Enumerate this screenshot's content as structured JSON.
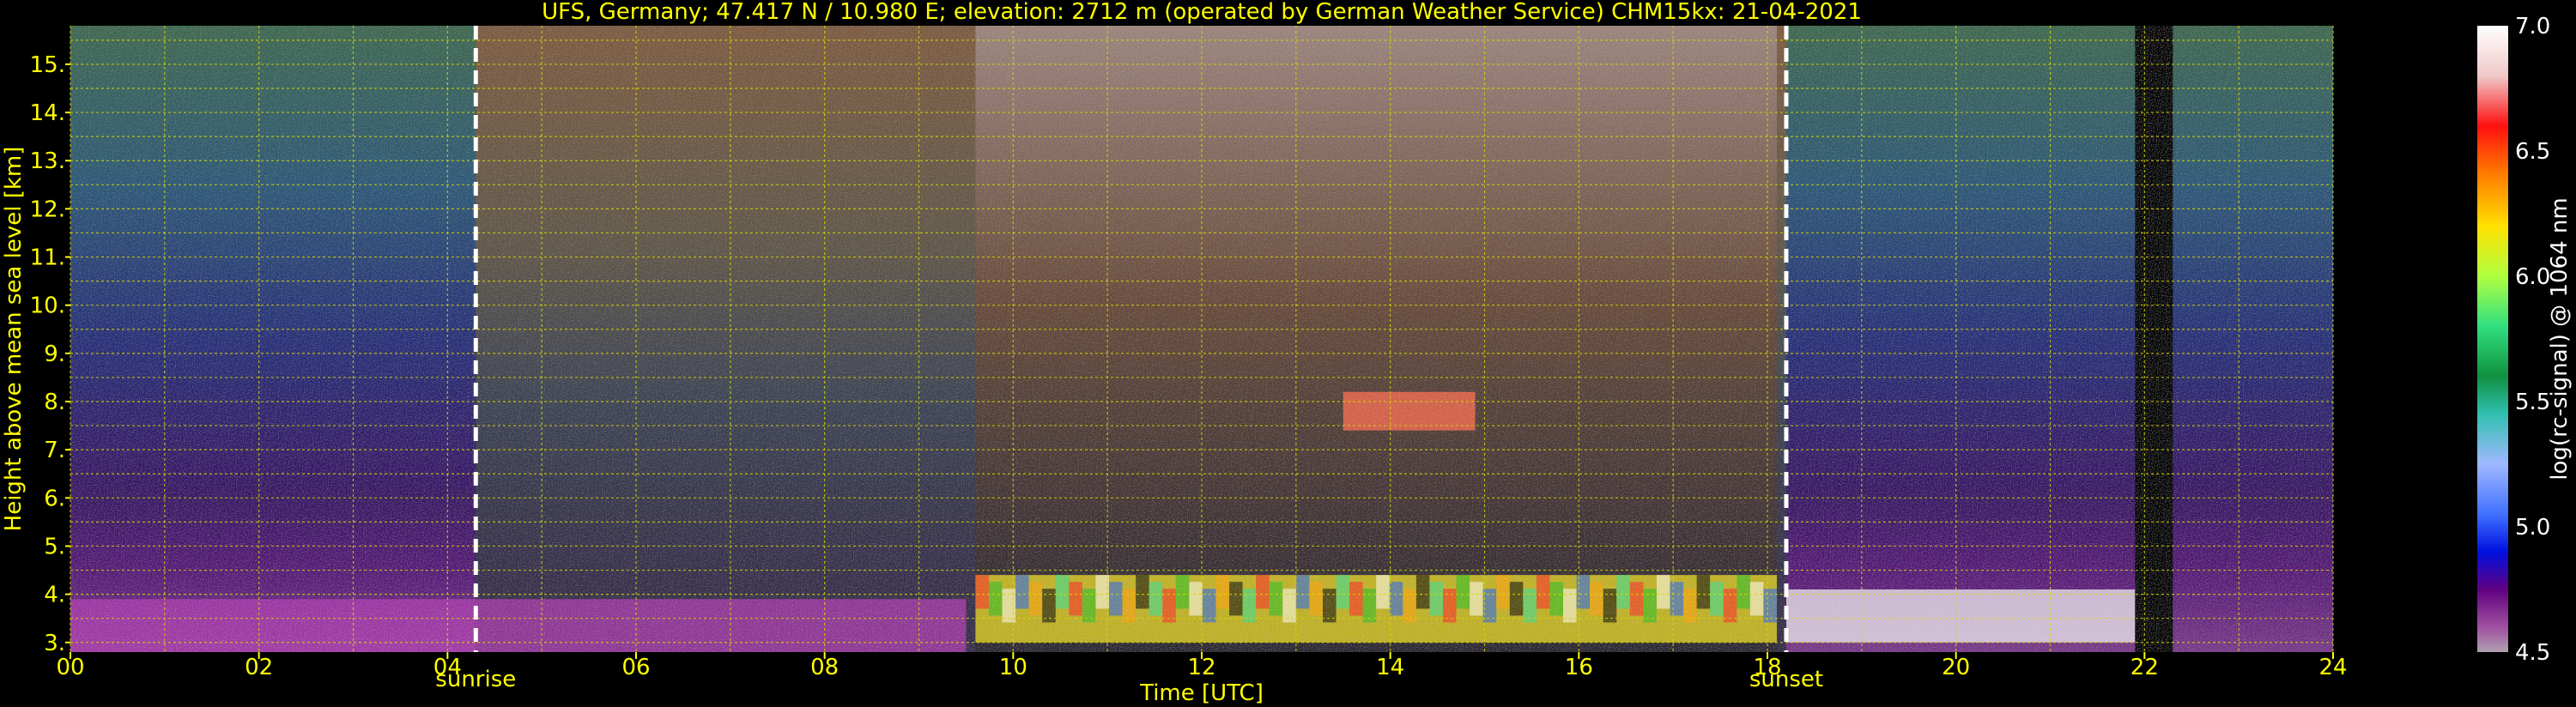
{
  "chart_data": {
    "type": "heatmap",
    "title": "UFS, Germany; 47.417 N / 10.980 E; elevation: 2712 m  (operated by German Weather Service)     CHM15kx: 21-04-2021",
    "xlabel": "Time [UTC]",
    "ylabel": "Height above mean sea level [km]",
    "xlim": [
      0,
      24
    ],
    "ylim": [
      2.8,
      15.8
    ],
    "x_ticks": [
      "00",
      "02",
      "04",
      "06",
      "08",
      "10",
      "12",
      "14",
      "16",
      "18",
      "20",
      "22",
      "24"
    ],
    "y_ticks": [
      "3.",
      "4.",
      "5.",
      "6.",
      "7.",
      "8.",
      "9.",
      "10.",
      "11.",
      "12.",
      "13.",
      "14.",
      "15."
    ],
    "grid": true,
    "annotations": [
      {
        "label": "sunrise",
        "x": 4.3
      },
      {
        "label": "sunset",
        "x": 18.2
      }
    ],
    "colorbar": {
      "label": "log(rc-signal) @ 1064 nm",
      "range": [
        4.5,
        7.0
      ],
      "ticks": [
        "7.0",
        "6.5",
        "6.0",
        "5.5",
        "5.0",
        "4.5"
      ]
    },
    "features": [
      {
        "name": "aerosol layer",
        "x_range": [
          0,
          9.5
        ],
        "height_km": [
          2.8,
          3.9
        ]
      },
      {
        "name": "low cloud",
        "x_range": [
          9.6,
          18.1
        ],
        "height_km": [
          3.0,
          4.4
        ]
      },
      {
        "name": "mid cloud",
        "x_range": [
          13.5,
          14.9
        ],
        "height_km": [
          7.4,
          8.2
        ]
      },
      {
        "name": "night clouds",
        "x_range": [
          18.2,
          21.9
        ],
        "height_km": [
          3.0,
          4.1
        ]
      },
      {
        "name": "data gap",
        "x_range": [
          21.9,
          22.3
        ],
        "height_km": [
          2.8,
          15.8
        ]
      }
    ]
  }
}
